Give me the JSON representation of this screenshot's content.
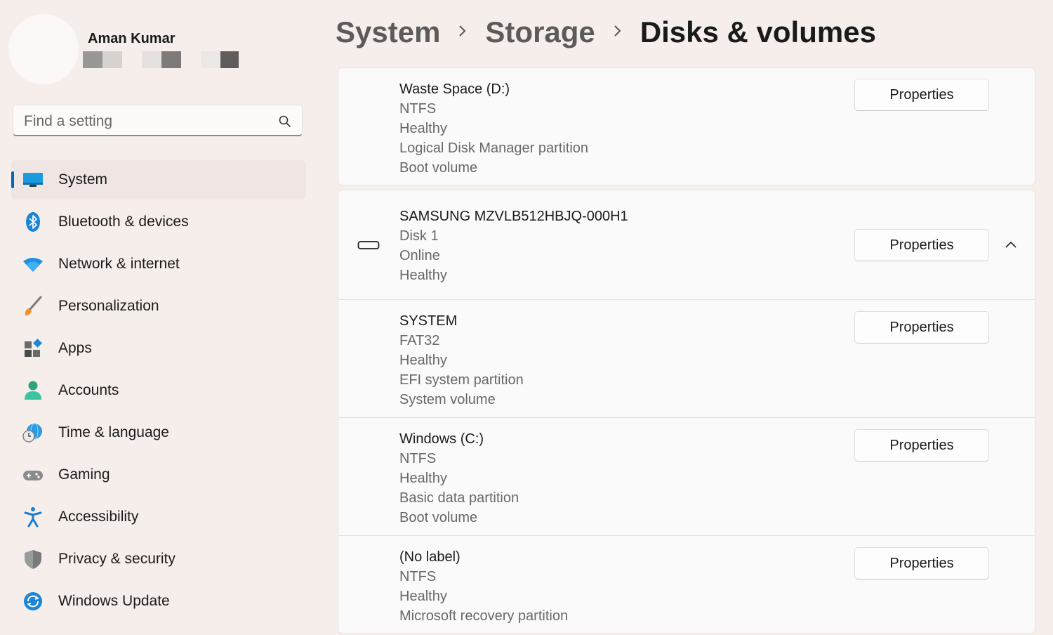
{
  "user": {
    "name": "Aman Kumar"
  },
  "search": {
    "placeholder": "Find a setting"
  },
  "nav": [
    {
      "label": "System",
      "icon": "monitor-icon",
      "selected": true
    },
    {
      "label": "Bluetooth & devices",
      "icon": "bluetooth-icon"
    },
    {
      "label": "Network & internet",
      "icon": "wifi-icon"
    },
    {
      "label": "Personalization",
      "icon": "paintbrush-icon"
    },
    {
      "label": "Apps",
      "icon": "apps-icon"
    },
    {
      "label": "Accounts",
      "icon": "person-icon"
    },
    {
      "label": "Time & language",
      "icon": "globe-clock-icon"
    },
    {
      "label": "Gaming",
      "icon": "gamepad-icon"
    },
    {
      "label": "Accessibility",
      "icon": "accessibility-icon"
    },
    {
      "label": "Privacy & security",
      "icon": "shield-icon"
    },
    {
      "label": "Windows Update",
      "icon": "refresh-icon"
    }
  ],
  "breadcrumb": {
    "items": [
      "System",
      "Storage",
      "Disks & volumes"
    ]
  },
  "volumes_top": {
    "lines": [
      "Waste Space (D:)",
      "NTFS",
      "Healthy",
      "Logical Disk Manager partition",
      "Boot volume"
    ],
    "button": "Properties"
  },
  "disk": {
    "lines": [
      "SAMSUNG MZVLB512HBJQ-000H1",
      "Disk 1",
      "Online",
      "Healthy"
    ],
    "button": "Properties",
    "icon": "hard-drive-icon",
    "expanded": true
  },
  "volumes": [
    {
      "lines": [
        "SYSTEM",
        "FAT32",
        "Healthy",
        "EFI system partition",
        "System volume"
      ],
      "button": "Properties"
    },
    {
      "lines": [
        "Windows (C:)",
        "NTFS",
        "Healthy",
        "Basic data partition",
        "Boot volume"
      ],
      "button": "Properties"
    },
    {
      "lines": [
        "(No label)",
        "NTFS",
        "Healthy",
        "Microsoft recovery partition"
      ],
      "button": "Properties"
    }
  ],
  "colors": {
    "accent": "#0067c0",
    "background": "#f6eeeb"
  }
}
